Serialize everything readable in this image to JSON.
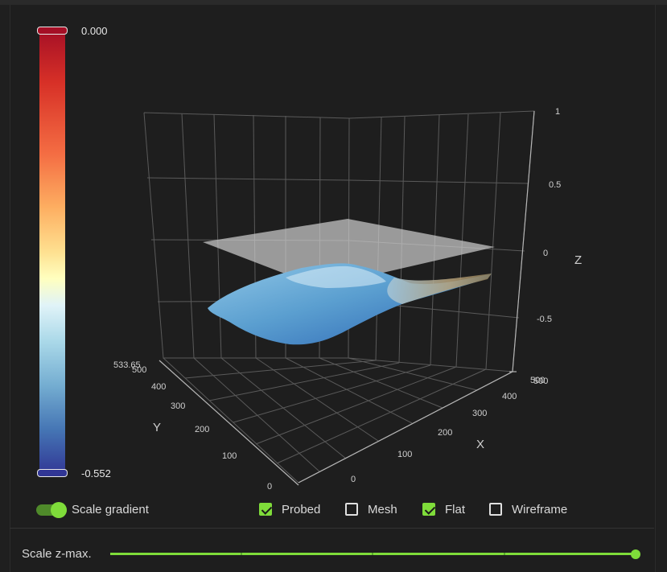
{
  "colorbar": {
    "max_label": "0.000",
    "min_label": "-0.552"
  },
  "plot": {
    "z_axis_title": "Z",
    "x_axis_title": "X",
    "y_axis_title": "Y",
    "z_ticks": [
      "1",
      "0.5",
      "0",
      "-0.5"
    ],
    "x_ticks": [
      "0",
      "100",
      "200",
      "300",
      "400",
      "500"
    ],
    "y_ticks": [
      "100",
      "200",
      "300",
      "400",
      "500"
    ],
    "y_max_label": "533.65",
    "x_max_label": "500",
    "y_zero_label": "0"
  },
  "controls": {
    "scale_gradient_label": "Scale gradient",
    "scale_gradient_on": true,
    "probed_label": "Probed",
    "probed_checked": true,
    "mesh_label": "Mesh",
    "mesh_checked": false,
    "flat_label": "Flat",
    "flat_checked": true,
    "wireframe_label": "Wireframe",
    "wireframe_checked": false
  },
  "slider": {
    "label": "Scale z-max.",
    "value_fraction": 1.0
  },
  "colors": {
    "accent": "#7fdc3a"
  }
}
